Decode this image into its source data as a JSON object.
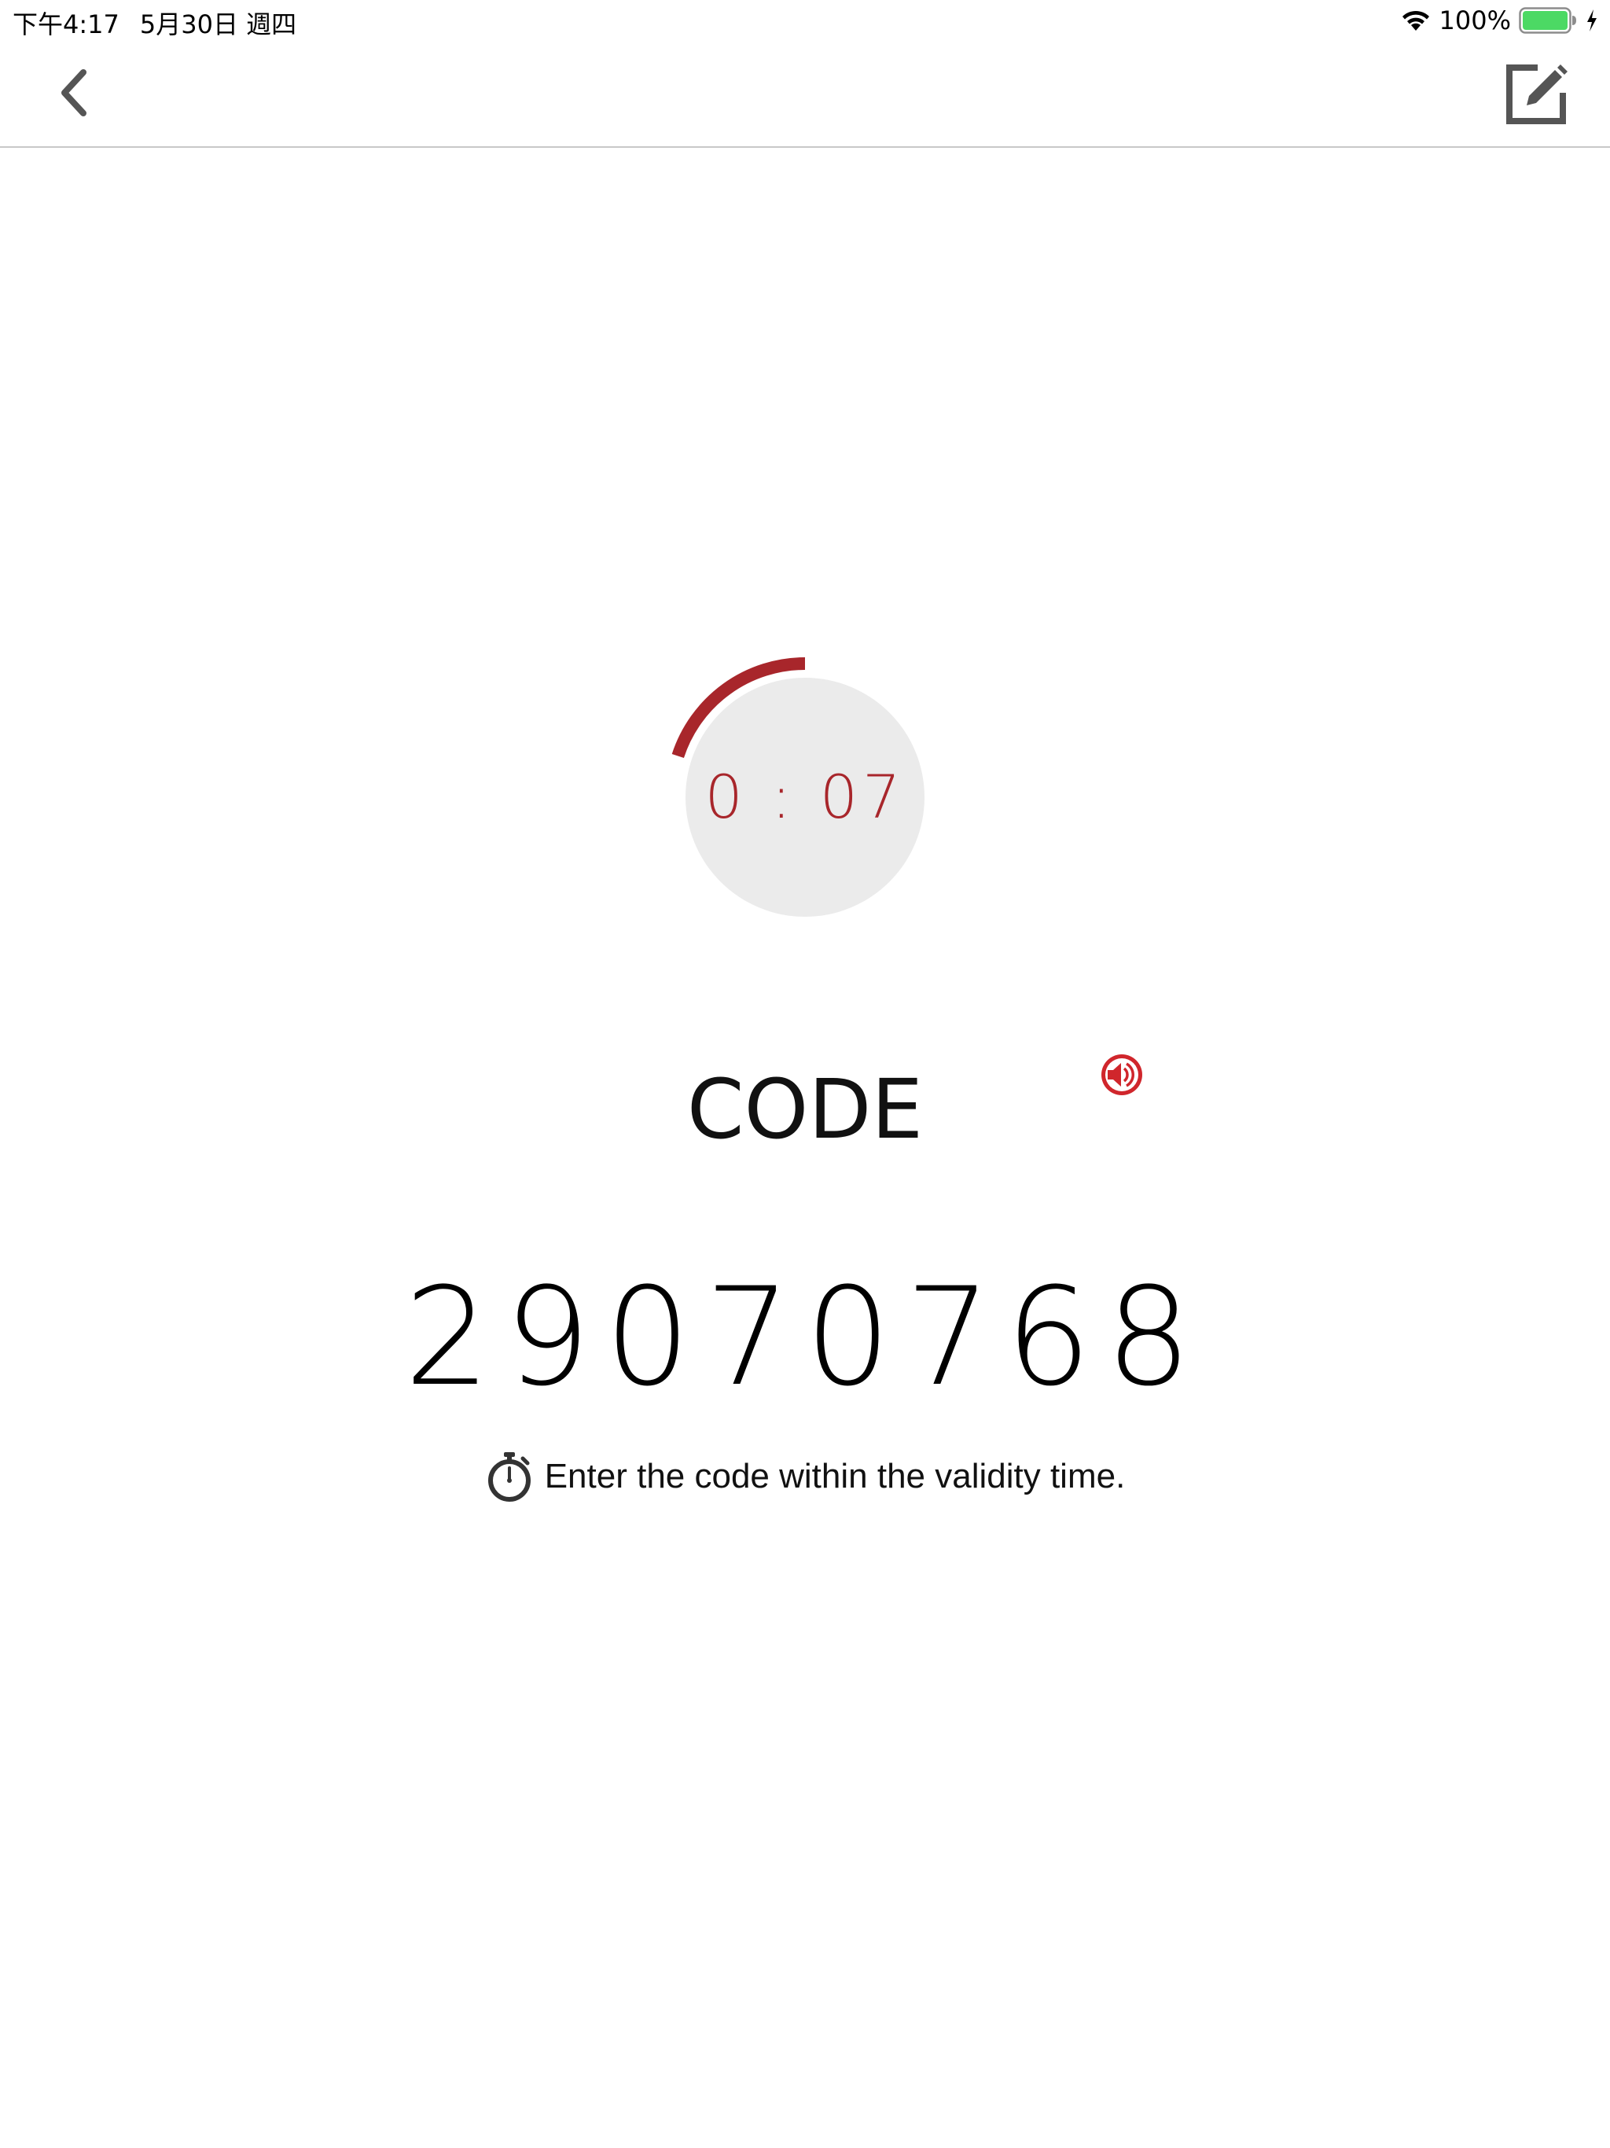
{
  "status_bar": {
    "time": "下午4:17",
    "date": "5月30日 週四",
    "battery_percent": "100%",
    "icons": [
      "wifi-icon",
      "battery-icon",
      "charging-icon"
    ],
    "battery_color": "#4cd964"
  },
  "nav": {
    "back_icon": "chevron-left-icon",
    "edit_icon": "edit-icon",
    "icon_color": "#555555"
  },
  "timer": {
    "display": "0 : 07",
    "remaining_fraction": 0.2,
    "accent_color": "#a8262b",
    "track_color": "#ebebeb"
  },
  "code": {
    "label": "CODE",
    "value": "29070768",
    "speaker_icon": "speaker-icon",
    "speaker_color": "#d0262c"
  },
  "hint": {
    "icon": "stopwatch-icon",
    "text": "Enter the code within the validity time."
  }
}
